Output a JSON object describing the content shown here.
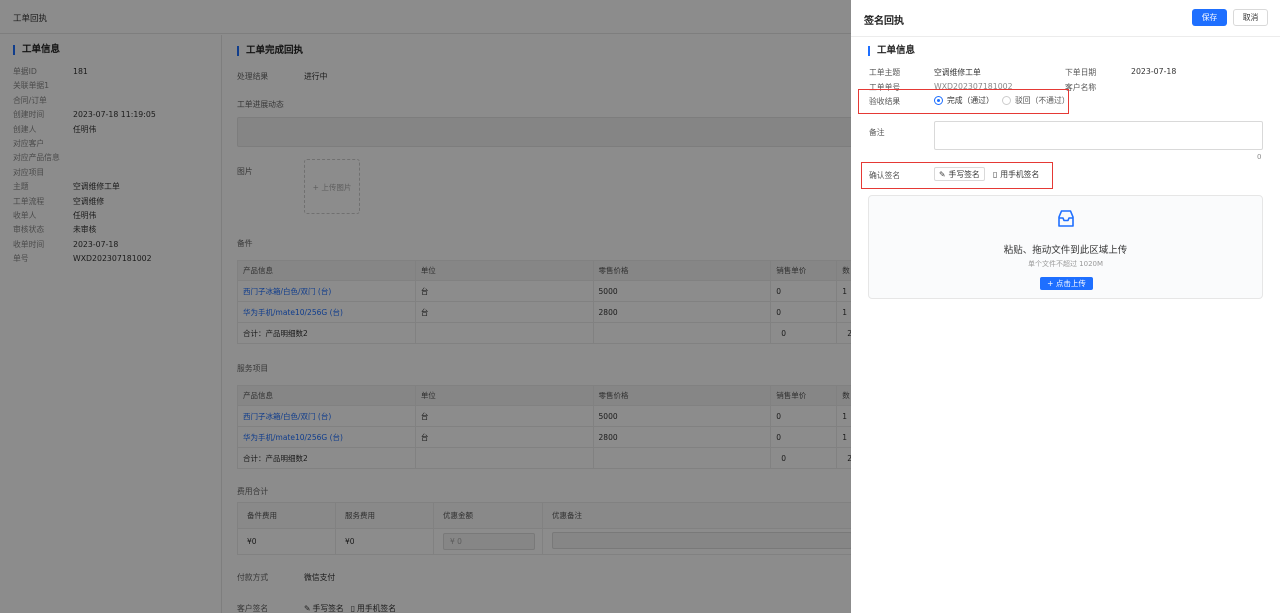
{
  "top_bar": {
    "title": "工单回执"
  },
  "left_panel": {
    "title": "工单信息",
    "rows": [
      {
        "k": "单据ID",
        "v": "181"
      },
      {
        "k": "关联单据1",
        "v": ""
      },
      {
        "k": "合同/订单",
        "v": ""
      },
      {
        "k": "创建时间",
        "v": "2023-07-18 11:19:05"
      },
      {
        "k": "创建人",
        "v": "任明伟"
      },
      {
        "k": "对应客户",
        "v": ""
      },
      {
        "k": "对应产品信息",
        "v": ""
      },
      {
        "k": "对应项目",
        "v": ""
      },
      {
        "k": "主题",
        "v": "空调维修工单"
      },
      {
        "k": "工单流程",
        "v": "空调维修"
      },
      {
        "k": "收单人",
        "v": "任明伟"
      },
      {
        "k": "审核状态",
        "v": "未审核"
      },
      {
        "k": "收单时间",
        "v": "2023-07-18"
      },
      {
        "k": "单号",
        "v": "WXD202307181002"
      }
    ]
  },
  "main": {
    "title": "工单完成回执",
    "result_label": "处理结果",
    "result_value": "进行中",
    "progress_label": "工单进展动态",
    "image_label": "图片",
    "upload_image": "+ 上传图片",
    "parts_label": "备件",
    "service_label": "服务项目",
    "table_headers": [
      "产品信息",
      "单位",
      "零售价格",
      "销售单价",
      "数"
    ],
    "table_rows": [
      {
        "product": "西门子冰箱/白色/双门 (台)",
        "unit": "台",
        "retail": "5000",
        "price": "0",
        "qty": "1"
      },
      {
        "product": "华为手机/mate10/256G (台)",
        "unit": "台",
        "retail": "2800",
        "price": "0",
        "qty": "1"
      }
    ],
    "total_label": "合计：产品明细数2",
    "total_price": "0",
    "total_qty": "2",
    "fee_label": "费用合计",
    "fee_headers": [
      "备件费用",
      "服务费用",
      "优惠金额",
      "优惠备注"
    ],
    "fee_values": [
      "¥0",
      "¥0",
      "¥ 0",
      ""
    ],
    "pay_label": "付款方式",
    "pay_value": "微信支付",
    "customer_sig_label": "客户签名",
    "handwrite_label": "手写签名",
    "phone_sig_label": "用手机签名"
  },
  "drawer": {
    "title": "签名回执",
    "save": "保存",
    "cancel": "取消",
    "section_title": "工单信息",
    "subject_label": "工单主题",
    "subject_value": "空调维修工单",
    "date_label": "下单日期",
    "date_value": "2023-07-18",
    "no_label": "工单单号",
    "no_value": "WXD202307181002",
    "customer_label": "客户名称",
    "check_label": "验收结果",
    "opt_pass": "完成（通过）",
    "opt_reject": "驳回（不通过）",
    "remark_label": "备注",
    "remark_count": "0",
    "confirm_label": "确认签名",
    "handwrite": "手写签名",
    "phone_sig": "用手机签名",
    "dz_title": "粘贴、拖动文件到此区域上传",
    "dz_sub": "单个文件不超过 1020M",
    "dz_btn": "+ 点击上传"
  },
  "colors": {
    "accent": "#1e6fff",
    "highlight": "#e53935",
    "mask": "rgba(0,0,0,0.45)"
  }
}
